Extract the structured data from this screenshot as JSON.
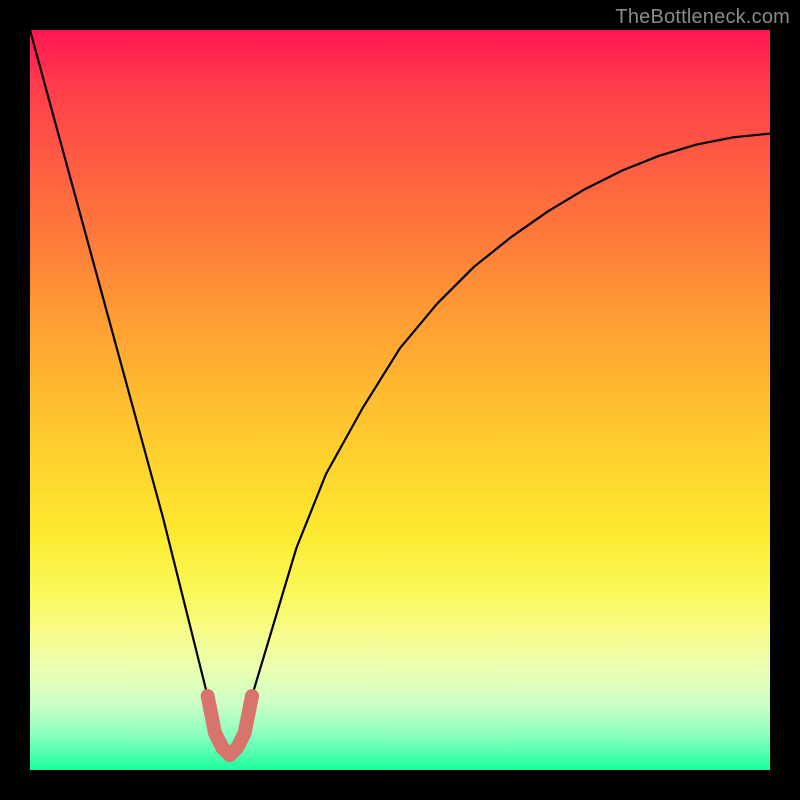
{
  "watermark": "TheBottleneck.com",
  "chart_data": {
    "type": "line",
    "title": "",
    "xlabel": "",
    "ylabel": "",
    "xlim": [
      0,
      100
    ],
    "ylim": [
      0,
      100
    ],
    "grid": false,
    "description": "V-shaped bottleneck curve over rainbow gradient background (red top = bad, green bottom = good). Minimum near x≈27. A short salmon segment marks the bottom of the V (optimal zone).",
    "series": [
      {
        "name": "curve",
        "color": "#000000",
        "x": [
          0,
          3,
          6,
          9,
          12,
          15,
          18,
          21,
          24,
          25,
          27,
          29,
          30,
          33,
          36,
          40,
          45,
          50,
          55,
          60,
          65,
          70,
          75,
          80,
          85,
          90,
          95,
          100
        ],
        "y": [
          100,
          89,
          78,
          67,
          56,
          45,
          34,
          22,
          10,
          5,
          2,
          5,
          10,
          20,
          30,
          40,
          49,
          57,
          63,
          68,
          72,
          75.5,
          78.5,
          81,
          83,
          84.5,
          85.5,
          86
        ]
      },
      {
        "name": "optimal-marker",
        "color": "#d9746c",
        "x": [
          24,
          25,
          26,
          27,
          28,
          29,
          30
        ],
        "y": [
          10,
          5,
          3,
          2,
          3,
          5,
          10
        ]
      }
    ]
  }
}
